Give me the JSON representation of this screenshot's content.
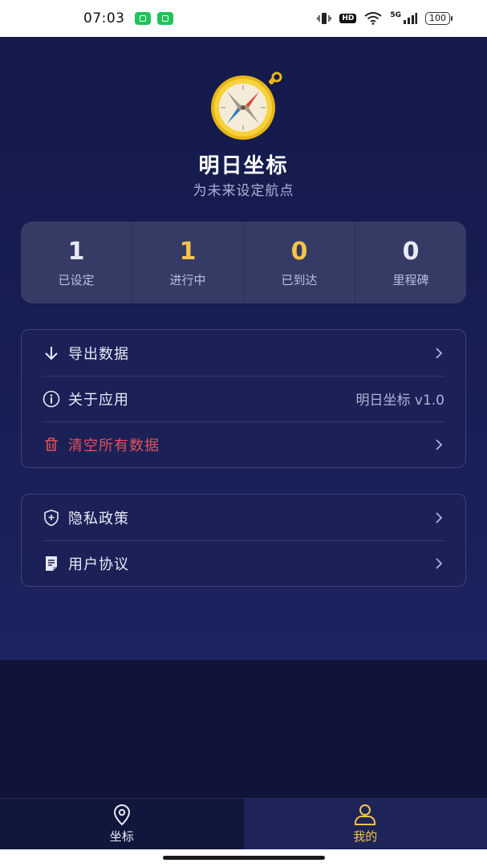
{
  "status_bar": {
    "time": "07:03",
    "network": "5G",
    "hd_badge": "HD",
    "battery": "100"
  },
  "header": {
    "app_name": "明日坐标",
    "slogan": "为未来设定航点",
    "logo_icon": "compass-icon"
  },
  "stats": [
    {
      "value": "1",
      "label": "已设定",
      "color": "#e8eaf8"
    },
    {
      "value": "1",
      "label": "进行中",
      "color": "#f5c44a"
    },
    {
      "value": "0",
      "label": "已到达",
      "color": "#f5c44a"
    },
    {
      "value": "0",
      "label": "里程碑",
      "color": "#e8eaf8"
    }
  ],
  "menu_data": {
    "export": {
      "label": "导出数据",
      "icon": "arrow-down-icon"
    },
    "about": {
      "label": "关于应用",
      "value": "明日坐标 v1.0",
      "icon": "info-icon"
    },
    "clear": {
      "label": "清空所有数据",
      "icon": "trash-icon",
      "color": "#e0505a"
    }
  },
  "menu_legal": {
    "privacy": {
      "label": "隐私政策",
      "icon": "shield-plus-icon"
    },
    "terms": {
      "label": "用户协议",
      "icon": "document-icon"
    }
  },
  "tabbar": {
    "tabs": [
      {
        "label": "坐标",
        "icon": "location-pin-icon",
        "active": false,
        "color": "#e8eaf8"
      },
      {
        "label": "我的",
        "icon": "user-icon",
        "active": true,
        "color": "#f5c44a"
      }
    ]
  },
  "colors": {
    "background": "#0f1438",
    "accent": "#f5c44a",
    "danger": "#e0505a"
  }
}
